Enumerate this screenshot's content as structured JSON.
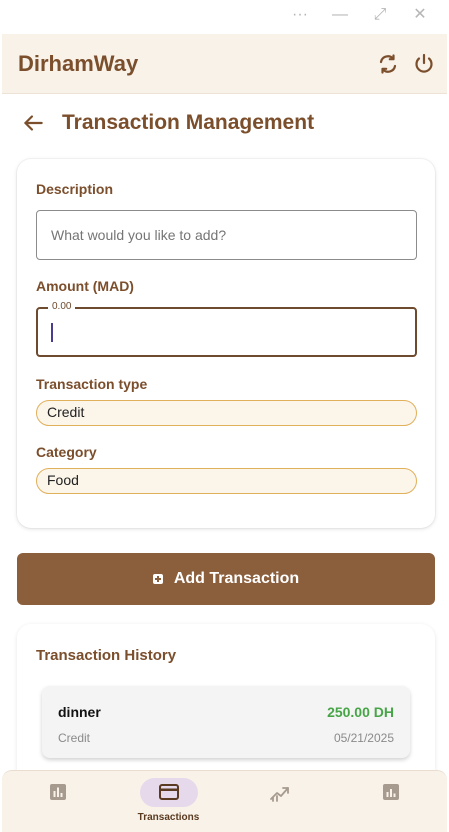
{
  "window": {
    "controls": [
      "···",
      "—",
      "⤢",
      "✕"
    ]
  },
  "app": {
    "title": "DirhamWay",
    "sync_icon": "refresh-icon",
    "power_icon": "power-icon"
  },
  "page": {
    "title": "Transaction Management",
    "back_icon": "arrow-back-icon"
  },
  "form": {
    "description_label": "Description",
    "description_placeholder": "What would you like to add?",
    "description_value": "",
    "amount_label": "Amount (MAD)",
    "amount_placeholder": "0.00",
    "amount_value": "",
    "type_label": "Transaction type",
    "type_value": "Credit",
    "category_label": "Category",
    "category_value": "Food"
  },
  "actions": {
    "add_label": "Add Transaction",
    "add_icon": "add-box-icon"
  },
  "history": {
    "title": "Transaction History",
    "items": [
      {
        "description": "dinner",
        "amount": "250.00 DH",
        "type": "Credit",
        "date": "05/21/2025"
      }
    ]
  },
  "nav": {
    "items": [
      {
        "label": "",
        "icon": "bar-chart-icon",
        "active": false
      },
      {
        "label": "Transactions",
        "icon": "credit-card-icon",
        "active": true
      },
      {
        "label": "",
        "icon": "trending-up-icon",
        "active": false
      },
      {
        "label": "",
        "icon": "analytics-icon",
        "active": false
      }
    ]
  },
  "colors": {
    "brand": "#7b4e2c",
    "button": "#8b5e3c",
    "app_bar_bg": "#f8f2e9",
    "credit_amount": "#47a447",
    "pill_border": "#e1b05b",
    "nav_active_pill": "#e6d9ec"
  }
}
